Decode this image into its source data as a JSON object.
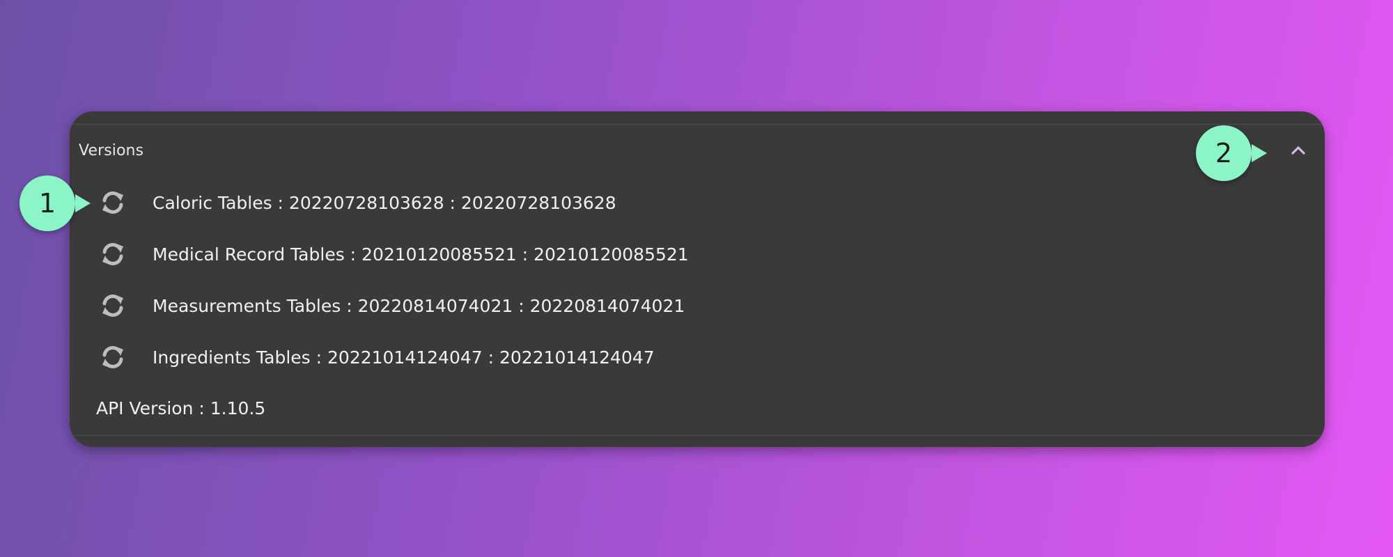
{
  "versions": {
    "title": "Versions",
    "collapse_icon": "chevron-up-icon",
    "items": [
      {
        "label": "Caloric Tables : 20220728103628 : 20220728103628",
        "icon": "refresh-icon"
      },
      {
        "label": "Medical Record Tables : 20210120085521 : 20210120085521",
        "icon": "refresh-icon"
      },
      {
        "label": "Measurements Tables : 20220814074021 : 20220814074021",
        "icon": "refresh-icon"
      },
      {
        "label": "Ingredients Tables : 20221014124047 : 20221014124047",
        "icon": "refresh-icon"
      }
    ],
    "api_version": "API Version : 1.10.5"
  },
  "callouts": {
    "first": "1",
    "second": "2"
  },
  "colors": {
    "panel": "#3a3a3a",
    "callout": "#8cf5c7",
    "chevron": "#d8b6e8"
  }
}
